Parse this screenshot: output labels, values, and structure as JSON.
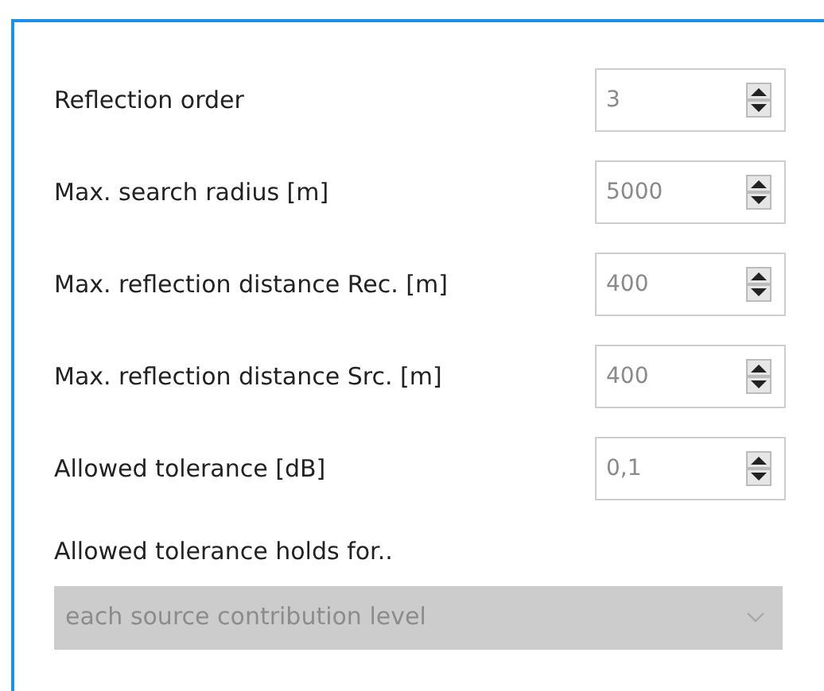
{
  "fields": [
    {
      "label": "Reflection order",
      "value": "3"
    },
    {
      "label": "Max. search radius [m]",
      "value": "5000"
    },
    {
      "label": "Max. reflection distance Rec. [m]",
      "value": "400"
    },
    {
      "label": "Max. reflection distance Src. [m]",
      "value": "400"
    },
    {
      "label": "Allowed tolerance [dB]",
      "value": "0,1"
    }
  ],
  "tolerance_scope": {
    "label": "Allowed tolerance holds for..",
    "value": "each source contribution level",
    "disabled": true
  }
}
